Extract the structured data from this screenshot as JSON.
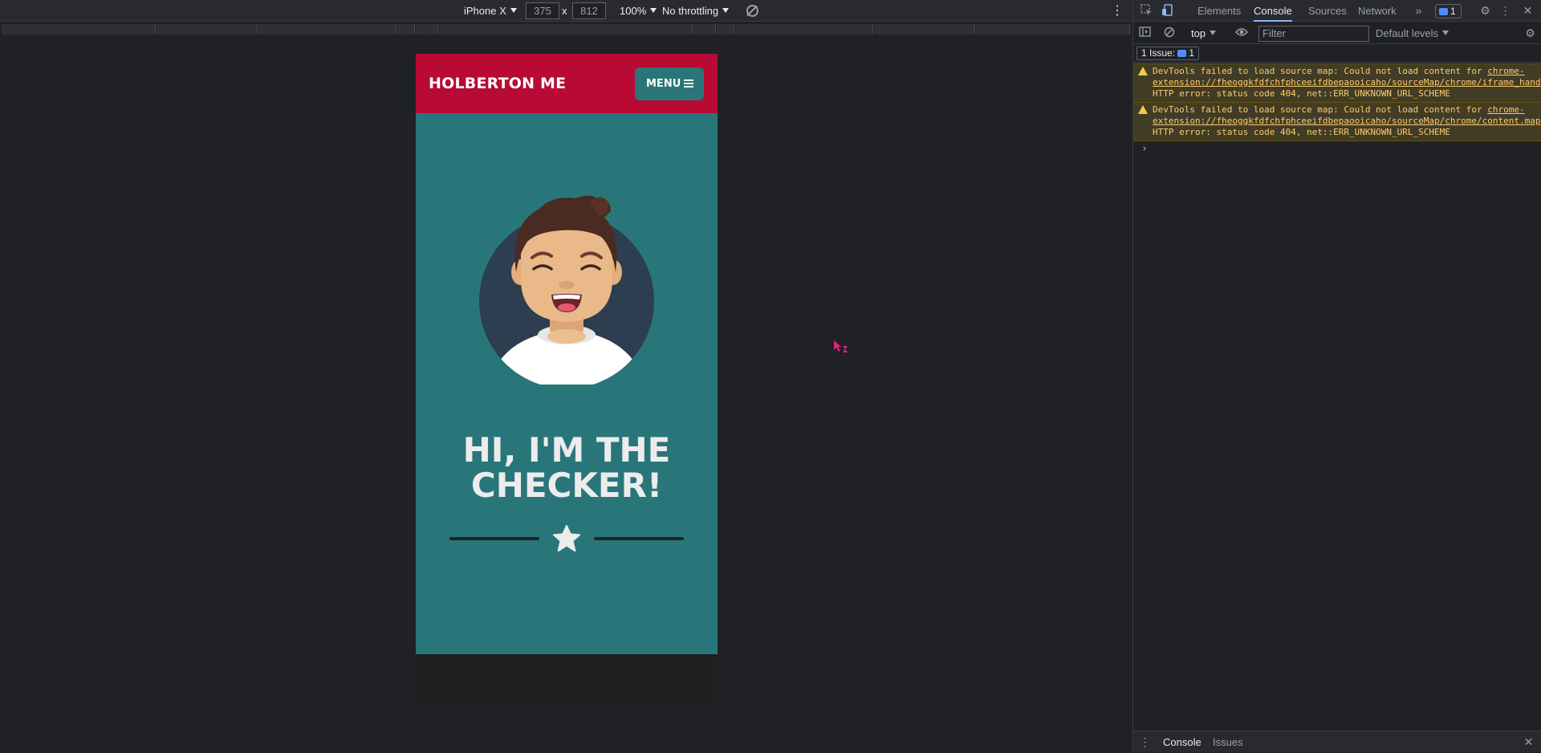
{
  "device_toolbar": {
    "device": "iPhone X",
    "width": "375",
    "times": "x",
    "height": "812",
    "zoom": "100%",
    "throttling": "No throttling"
  },
  "site": {
    "logo": "HOLBERTON ME",
    "menu_label": "MENU",
    "hero_title": "HI, I'M THE CHECKER!",
    "colors": {
      "header": "#b80a34",
      "hero": "#29767a",
      "menu_button": "#2a7578"
    }
  },
  "devtools": {
    "tabs": [
      "Elements",
      "Console",
      "Sources",
      "Network"
    ],
    "active_tab": "Console",
    "issues_badge": "1",
    "context": "top",
    "filter_placeholder": "Filter",
    "levels": "Default levels",
    "issues_bar_label": "1 Issue:",
    "issues_bar_count": "1",
    "messages": [
      {
        "prefix": "DevTools failed to load source map: Could not load content for ",
        "link": "chrome-extension://fheoggkfdfchfphceeifdbepaooicaho/sourceMap/chrome/iframe_handler.map",
        "suffix": ": HTTP error: status code 404, net::ERR_UNKNOWN_URL_SCHEME"
      },
      {
        "prefix": "DevTools failed to load source map: Could not load content for ",
        "link": "chrome-extension://fheoggkfdfchfphceeifdbepaooicaho/sourceMap/chrome/content.map",
        "suffix": ": HTTP error: status code 404, net::ERR_UNKNOWN_URL_SCHEME"
      }
    ],
    "prompt": "›",
    "drawer_tabs": [
      "Console",
      "Issues"
    ]
  },
  "icons": {
    "inspect": "inspect-element-icon",
    "device": "device-toggle-icon",
    "more_tabs": "double-chevron-icon",
    "settings": "gear-icon",
    "kebab": "kebab-menu-icon",
    "close": "close-icon"
  }
}
